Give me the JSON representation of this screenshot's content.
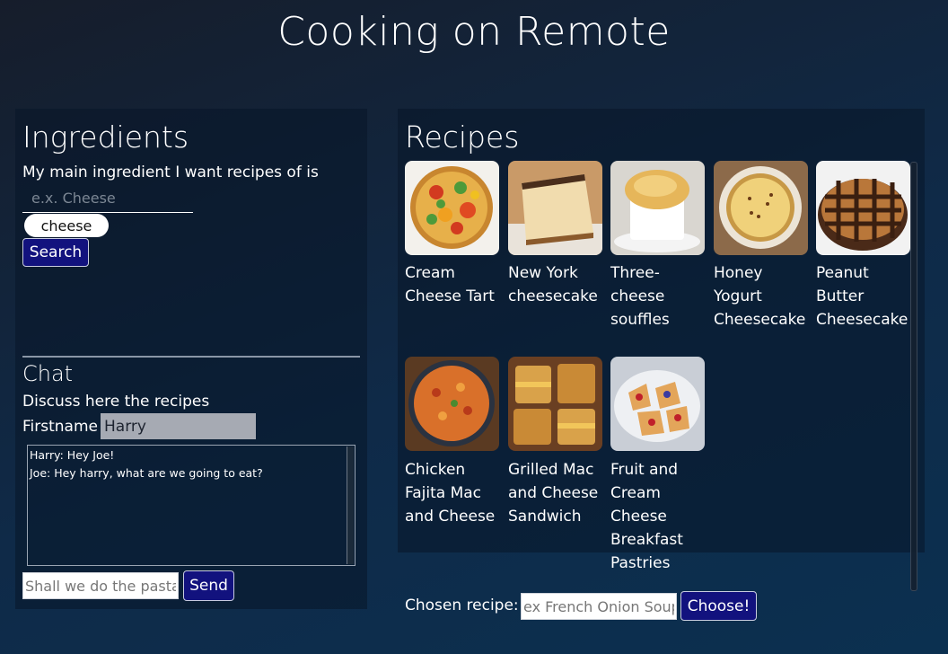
{
  "app": {
    "title": "Cooking on Remote"
  },
  "ingredients": {
    "heading": "Ingredients",
    "prompt": "My main ingredient I want recipes of is",
    "input_placeholder": "e.x. Cheese",
    "chip": "cheese",
    "search_label": "Search"
  },
  "chat": {
    "heading": "Chat",
    "subtitle": "Discuss here the recipes",
    "firstname_label": "Firstname",
    "firstname_value": "Harry",
    "messages": [
      "Harry: Hey Joe!",
      "Joe: Hey harry, what are we going to eat?"
    ],
    "message_placeholder": "Shall we do the pasta?",
    "send_label": "Send"
  },
  "recipes": {
    "heading": "Recipes",
    "items": [
      {
        "label": "Cream Cheese Tart"
      },
      {
        "label": "New York cheesecake"
      },
      {
        "label": "Three-cheese souffles"
      },
      {
        "label": "Honey Yogurt Cheesecake"
      },
      {
        "label": "Peanut Butter Cheesecake"
      },
      {
        "label": "Chicken Fajita Mac and Cheese"
      },
      {
        "label": "Grilled Mac and Cheese Sandwich"
      },
      {
        "label": "Fruit and Cream Cheese Breakfast Pastries"
      }
    ],
    "chosen_label": "Chosen recipe:",
    "chosen_placeholder": "ex French Onion Soup",
    "choose_label": "Choose!"
  }
}
